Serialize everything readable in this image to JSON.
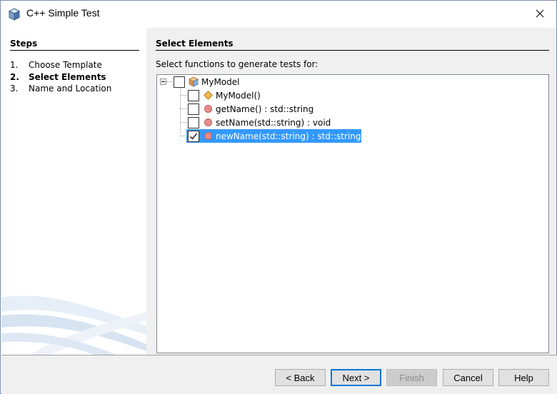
{
  "window": {
    "title": "C++ Simple Test",
    "icon": "cube-icon",
    "close_icon": "close-icon"
  },
  "steps": {
    "title": "Steps",
    "items": [
      {
        "num": "1.",
        "label": "Choose Template",
        "current": false
      },
      {
        "num": "2.",
        "label": "Select Elements",
        "current": true
      },
      {
        "num": "3.",
        "label": "Name and Location",
        "current": false
      }
    ]
  },
  "main": {
    "title": "Select Elements",
    "instruction": "Select functions to generate tests for:",
    "tree": {
      "root": {
        "label": "MyModel",
        "checked": false,
        "expanded": true,
        "icon": "class-icon"
      },
      "children": [
        {
          "label": "MyModel()",
          "checked": false,
          "icon": "constructor-icon",
          "selected": false
        },
        {
          "label": "getName() : std::string",
          "checked": false,
          "icon": "method-icon",
          "selected": false
        },
        {
          "label": "setName(std::string) : void",
          "checked": false,
          "icon": "method-icon",
          "selected": false
        },
        {
          "label": "newName(std::string) : std::string",
          "checked": true,
          "icon": "method-icon",
          "selected": true
        }
      ]
    }
  },
  "buttons": {
    "back": "< Back",
    "next": "Next >",
    "finish": "Finish",
    "cancel": "Cancel",
    "help": "Help"
  },
  "colors": {
    "selection": "#3399ff",
    "panel_bg": "#f0f0f0",
    "primary_border": "#0078d7"
  }
}
